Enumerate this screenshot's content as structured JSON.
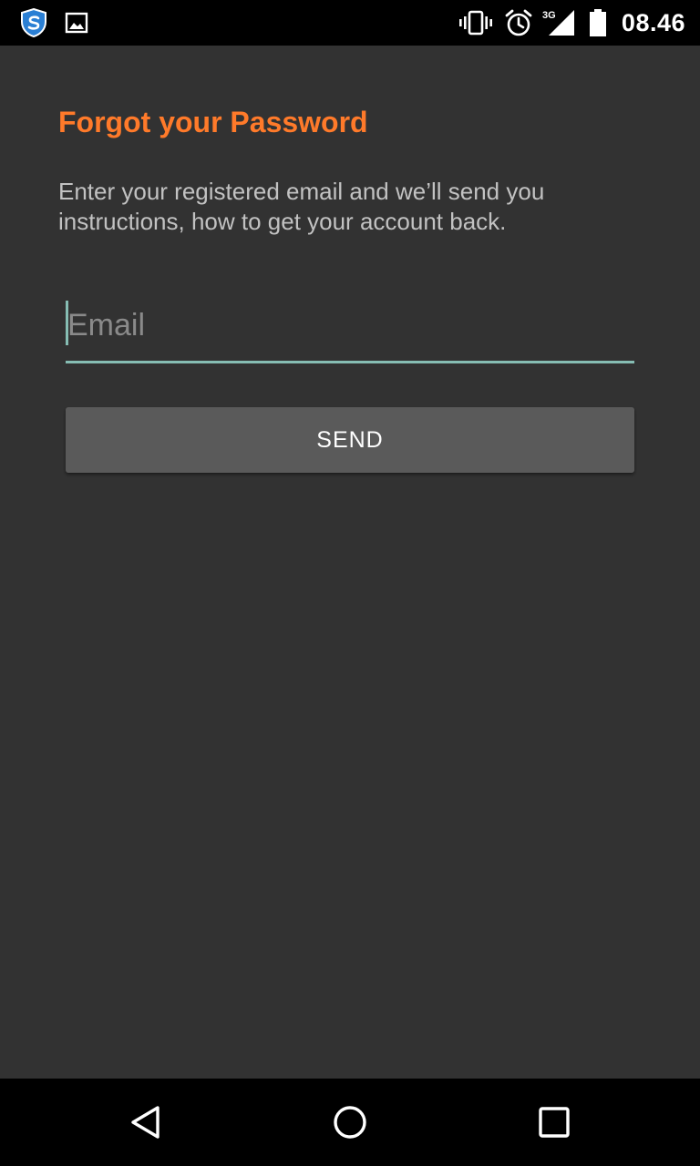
{
  "status_bar": {
    "time": "08.46",
    "network_type": "3G",
    "icons": [
      "shield-app-icon",
      "image-notification-icon",
      "vibrate-icon",
      "alarm-icon",
      "signal-icon",
      "battery-icon"
    ]
  },
  "forgot_password": {
    "title": "Forgot your Password",
    "description": "Enter your registered email and we’ll send you instructions, how to get your account back.",
    "email": {
      "value": "",
      "placeholder": "Email"
    },
    "send_label": "SEND"
  },
  "nav_bar": {
    "icons": [
      "back-icon",
      "home-icon",
      "recents-icon"
    ]
  },
  "colors": {
    "accent": "#ff7a2a",
    "input_underline": "#86bdb3",
    "background": "#323232",
    "button": "#5a5a5a"
  }
}
